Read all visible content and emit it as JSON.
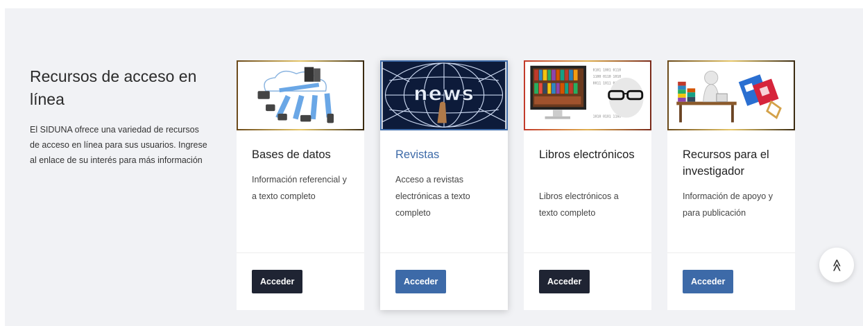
{
  "intro": {
    "title": "Recursos de acceso en línea",
    "description": "El SIDUNA ofrece una variedad de recursos de acceso en línea para sus usuarios. Ingrese al enlace de su interés para más información"
  },
  "cards": [
    {
      "title": "Bases de datos",
      "description": "Información referencial y a texto completo",
      "button": "Acceder"
    },
    {
      "title": "Revistas",
      "description": "Acceso a revistas electrónicas a texto completo",
      "button": "Acceder",
      "thumb_text": "news"
    },
    {
      "title": "Libros electrónicos",
      "description": "Libros electrónicos a texto completo",
      "button": "Acceder"
    },
    {
      "title": "Recursos para el investigador",
      "description": "Información de apoyo y para publicación",
      "button": "Acceder"
    }
  ],
  "scroll_top": {
    "icon": "double-chevron-up-icon",
    "glyph": "≫"
  },
  "colors": {
    "dark_button": "#1f2433",
    "accent_blue": "#3d6aa8",
    "section_bg": "#f1f2f5"
  }
}
